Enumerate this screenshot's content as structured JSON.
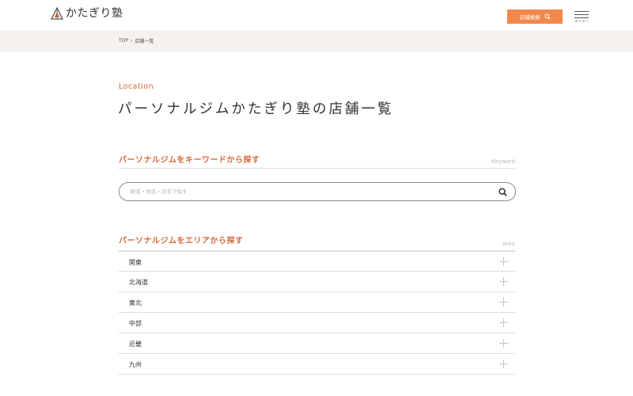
{
  "header": {
    "logo_text": "かたぎり塾",
    "store_search_label": "店舗検索",
    "menu_label": "メニュー"
  },
  "breadcrumb": {
    "items": [
      "TOP",
      "店舗一覧"
    ],
    "separator": "›"
  },
  "page": {
    "eyebrow": "Location",
    "title": "パーソナルジムかたぎり塾の店舗一覧"
  },
  "keyword_section": {
    "title": "パーソナルジムをキーワードから探す",
    "subtitle": "Keyword",
    "search_placeholder": "駅名・地名・店名で探す",
    "search_value": ""
  },
  "area_section": {
    "title": "パーソナルジムをエリアから探す",
    "subtitle": "Area",
    "areas": [
      "関東",
      "北海道",
      "東北",
      "中部",
      "近畿",
      "九州"
    ]
  },
  "colors": {
    "accent": "#d56a3a",
    "button": "#f2884b",
    "breadcrumb_bg": "#f4f1ef",
    "divider": "#dddddd"
  },
  "icons": {
    "logo": "triangle-logo-icon",
    "search": "search-icon",
    "menu": "hamburger-icon",
    "expand": "plus-icon"
  }
}
